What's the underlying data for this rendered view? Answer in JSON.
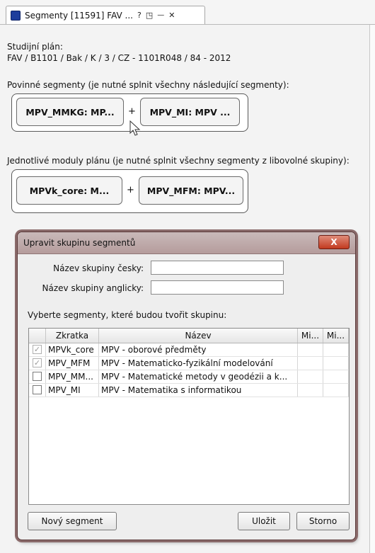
{
  "tab": {
    "title": "Segmenty [11591] FAV ...",
    "help": "?",
    "restore": "◳",
    "minimize": "—",
    "close": "✕"
  },
  "study_plan": {
    "label": "Studijní plán:",
    "value": "FAV / B1101 / Bak / K / 3 / CZ - 1101R048 / 84 - 2012"
  },
  "mandatory": {
    "heading": "Povinné segmenty (je nutné splnit všechny následující segmenty):",
    "segments": [
      "MPV_MMKG: MP...",
      "MPV_MI: MPV ..."
    ],
    "plus": "+"
  },
  "modules": {
    "heading": "Jednotlivé moduly plánu (je nutné splnit všechny segmenty z libovolné skupiny):",
    "segments": [
      "MPVk_core: M...",
      "MPV_MFM: MPV..."
    ],
    "plus": "+"
  },
  "dialog": {
    "title": "Upravit skupinu segmentů",
    "close": "X",
    "name_cz_label": "Název skupiny česky:",
    "name_cz_value": "",
    "name_en_label": "Název skupiny anglicky:",
    "name_en_value": "",
    "select_heading": "Vyberte segmenty, které budou tvořit skupinu:",
    "columns": [
      "",
      "Zkratka",
      "Název",
      "Mi...",
      "Mi..."
    ],
    "rows": [
      {
        "checked": true,
        "abbr": "MPVk_core",
        "name": "MPV - oborové předměty"
      },
      {
        "checked": true,
        "abbr": "MPV_MFM",
        "name": "MPV - Matematicko-fyzikální modelování"
      },
      {
        "checked": false,
        "abbr": "MPV_MM...",
        "name": "MPV - Matematické metody v geodézii a k..."
      },
      {
        "checked": false,
        "abbr": "MPV_MI",
        "name": "MPV - Matematika s informatikou"
      }
    ],
    "new_segment": "Nový segment",
    "save": "Uložit",
    "cancel": "Storno"
  }
}
